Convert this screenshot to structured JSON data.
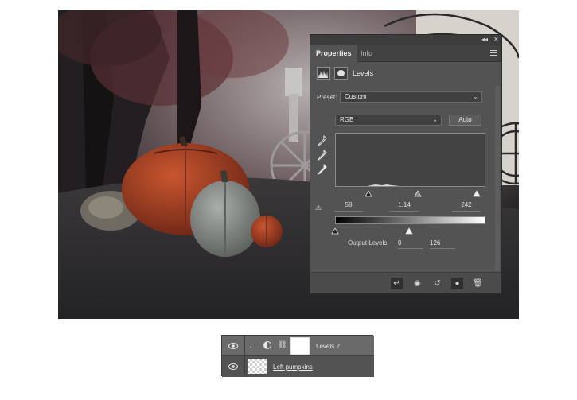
{
  "panel": {
    "tabs": [
      {
        "label": "Properties",
        "active": true
      },
      {
        "label": "Info",
        "active": false
      }
    ],
    "adjustment_title": "Levels",
    "preset_label": "Preset:",
    "preset_value": "Custom",
    "channel_value": "RGB",
    "auto_label": "Auto",
    "input_levels": {
      "black": "58",
      "gamma": "1.14",
      "white": "242"
    },
    "output_label": "Output Levels:",
    "output_levels": {
      "black": "0",
      "white": "126"
    }
  },
  "layers": {
    "rows": [
      {
        "name": "Levels 2",
        "selected": true
      },
      {
        "name": "Left pumpkins",
        "selected": false
      }
    ]
  },
  "colors": {
    "panel_bg": "#535353",
    "panel_dark": "#424242",
    "selected_layer": "#6a6a6a",
    "pumpkin_orange": "#b2472a",
    "pumpkin_grey": "#8b908c"
  }
}
